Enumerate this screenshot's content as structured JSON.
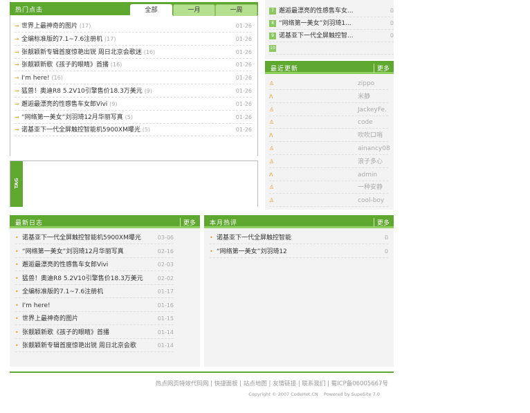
{
  "hot": {
    "title": "热门点击",
    "tabs": [
      "全部",
      "一月",
      "一周"
    ],
    "items": [
      {
        "title": "世界上最神奇的图片",
        "count": "(17)",
        "date": "01-26"
      },
      {
        "title": "全编标准版的7.1~7.6注册机",
        "count": "(17)",
        "date": "01-26"
      },
      {
        "title": "张靓颖新专辑首度惊艳出锐 周日北京会歌迷",
        "count": "(16)",
        "date": "01-26"
      },
      {
        "title": "张靓颖新歌《孩子的眼睛》首播",
        "count": "(16)",
        "date": "01-26"
      },
      {
        "title": "I'm here!",
        "count": "(16)",
        "date": "01-26"
      },
      {
        "title": "猛兽！奥迪R8 5.2V10引擎售价18.3万美元",
        "count": "(9)",
        "date": "01-26"
      },
      {
        "title": "邂逅最漂亮的性感售车女郎Vivi",
        "count": "(9)",
        "date": "01-26"
      },
      {
        "title": "“网络第一美女”刘羽琦12月华丽写真",
        "count": "(5)",
        "date": "01-26"
      },
      {
        "title": "诺基亚下一代全屏触控智能机5900XM曝光",
        "count": "(5)",
        "date": "01-26"
      }
    ]
  },
  "tag": {
    "label": "TAG"
  },
  "rank": {
    "items": [
      {
        "num": "7",
        "title": "邂逅最漂亮的性感售车女...",
        "count": "0"
      },
      {
        "num": "8",
        "title": "“网络第一美女”刘羽琦1...",
        "count": "0"
      },
      {
        "num": "9",
        "title": "诺基亚下一代全屏触控智...",
        "count": "0"
      },
      {
        "num": "10",
        "title": "",
        "count": ""
      }
    ]
  },
  "recent": {
    "title": "最近更新",
    "more": "更多",
    "users": [
      "zippo",
      "米静",
      "JackeyFe.",
      "code",
      "吹吹口哨",
      "ainancy08",
      "浪子多心",
      "admin",
      "一种安静",
      "cool-boy"
    ]
  },
  "blog": {
    "title": "最新日志",
    "more": "更多",
    "items": [
      {
        "title": "诺基亚下一代全屏触控智能机5900XM曝光",
        "date": "03-06"
      },
      {
        "title": "“网络第一美女”刘羽琦12月华丽写真",
        "date": "02-16"
      },
      {
        "title": "邂逅最漂亮的性感售车女郎Vivi",
        "date": "02-03"
      },
      {
        "title": "猛兽！奥迪R8 5.2V10引擎售价18.3万美元",
        "date": "02-02"
      },
      {
        "title": "全编标准版的7.1~7.6注册机",
        "date": "01-17"
      },
      {
        "title": "I'm here!",
        "date": "01-16"
      },
      {
        "title": "世界上最神奇的图片",
        "date": "01-15"
      },
      {
        "title": "张靓颖新歌《孩子的眼睛》首播",
        "date": "01-14"
      },
      {
        "title": "张靓颖新专辑首度惊艳出锐 周日北京会歌",
        "date": "01-14"
      }
    ]
  },
  "comments": {
    "title": "本月热评",
    "more": "更多",
    "items": [
      {
        "title": "诺基亚下一代全屏触控智能",
        "count": "0"
      },
      {
        "title": "“网络第一美女”刘羽琦12",
        "count": "0"
      }
    ]
  },
  "footer": {
    "links": "热点网页特效代码网 | 快捷面板 | 站点地图 | 友情链接 | 联系我们 | 蜀ICP备06005667号",
    "copyright": "Copyright © 2007 CodeHot.CN    Powered by SupeSite 7.0"
  }
}
